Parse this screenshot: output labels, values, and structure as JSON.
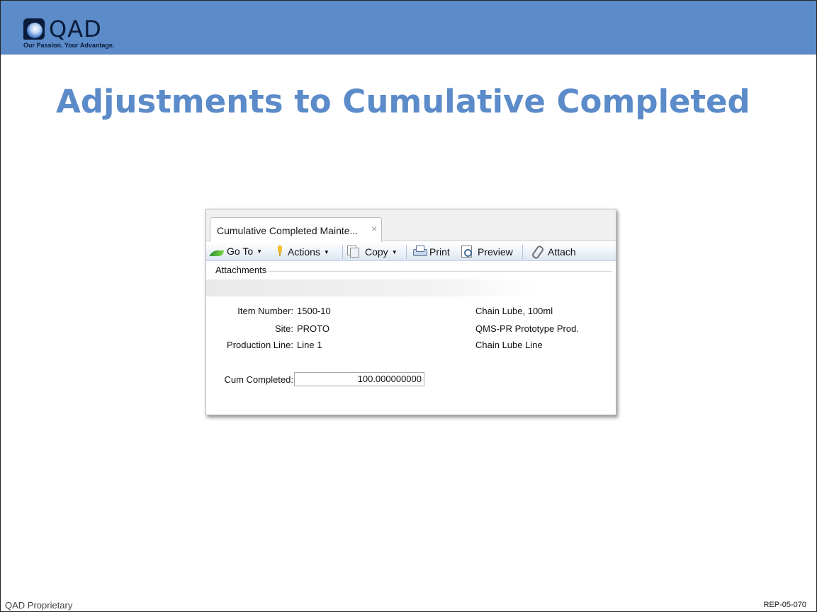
{
  "header": {
    "logo_word": "QAD",
    "logo_tagline": "Our Passion. Your Advantage."
  },
  "slide": {
    "title": "Adjustments to Cumulative Completed"
  },
  "window": {
    "tab_label": "Cumulative Completed Mainte...",
    "tab_close": "×",
    "toolbar": {
      "goto": "Go To",
      "actions": "Actions",
      "copy": "Copy",
      "print": "Print",
      "preview": "Preview",
      "attach": "Attach",
      "caret": "▼"
    },
    "attachments_label": "Attachments",
    "fields": {
      "item_number_label": "Item Number:",
      "item_number_value": "1500-10",
      "item_description": "Chain Lube, 100ml",
      "site_label": "Site:",
      "site_value": "PROTO",
      "site_description": "QMS-PR Prototype Prod.",
      "production_line_label": "Production Line:",
      "production_line_value": "Line 1",
      "production_line_description": "Chain Lube Line",
      "cum_completed_label": "Cum Completed:",
      "cum_completed_value": "100.000000000"
    }
  },
  "footer": {
    "left": "QAD Proprietary",
    "right": "REP-05-070"
  }
}
